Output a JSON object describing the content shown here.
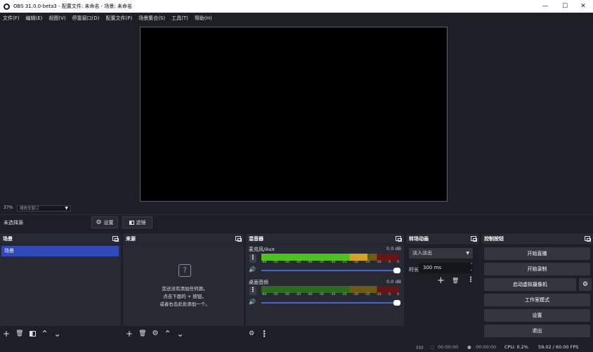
{
  "window": {
    "title": "OBS 31.0.0-beta3 - 配置文件: 未命名 - 场景: 未命名",
    "minimize": "—",
    "maximize": "☐",
    "close": "✕"
  },
  "menu": [
    "文件(F)",
    "编辑(E)",
    "视图(V)",
    "停靠窗口(D)",
    "配置文件(P)",
    "场景集合(S)",
    "工具(T)",
    "帮助(H)"
  ],
  "preview": {
    "zoom": "37%",
    "zoom_mode": "缩放至窗口"
  },
  "source_toolbar": {
    "no_source": "未选择源",
    "properties": "设置",
    "filters": "滤镜"
  },
  "scenes": {
    "title": "场景",
    "items": [
      "场景"
    ]
  },
  "sources": {
    "title": "来源",
    "empty_line1": "您还没有添加任何源。",
    "empty_line2": "点击下面的 + 按钮，",
    "empty_line3": "或者右击此处添加一个。"
  },
  "mixer": {
    "title": "混音器",
    "ticks": [
      "-60",
      "-55",
      "-50",
      "-45",
      "-40",
      "-35",
      "-30",
      "-25",
      "-20",
      "-15",
      "-10",
      "-5",
      "0"
    ],
    "channels": [
      {
        "name": "麦克风/Aux",
        "db": "0.0 dB"
      },
      {
        "name": "桌面音频",
        "db": "0.0 dB"
      }
    ]
  },
  "transitions": {
    "title": "转场动画",
    "selected": "淡入淡出",
    "duration_label": "时长",
    "duration": "300 ms"
  },
  "controls": {
    "title": "控制按钮",
    "start_streaming": "开始直播",
    "start_recording": "开始录制",
    "start_virtualcam": "启动虚拟摄像机",
    "studio_mode": "工作室模式",
    "settings": "设置",
    "exit": "退出"
  },
  "status": {
    "stream_time": "00:00:00",
    "record_time": "00:00:00",
    "cpu": "CPU: 0.2%",
    "fps": "59.02 / 60.00 FPS"
  }
}
